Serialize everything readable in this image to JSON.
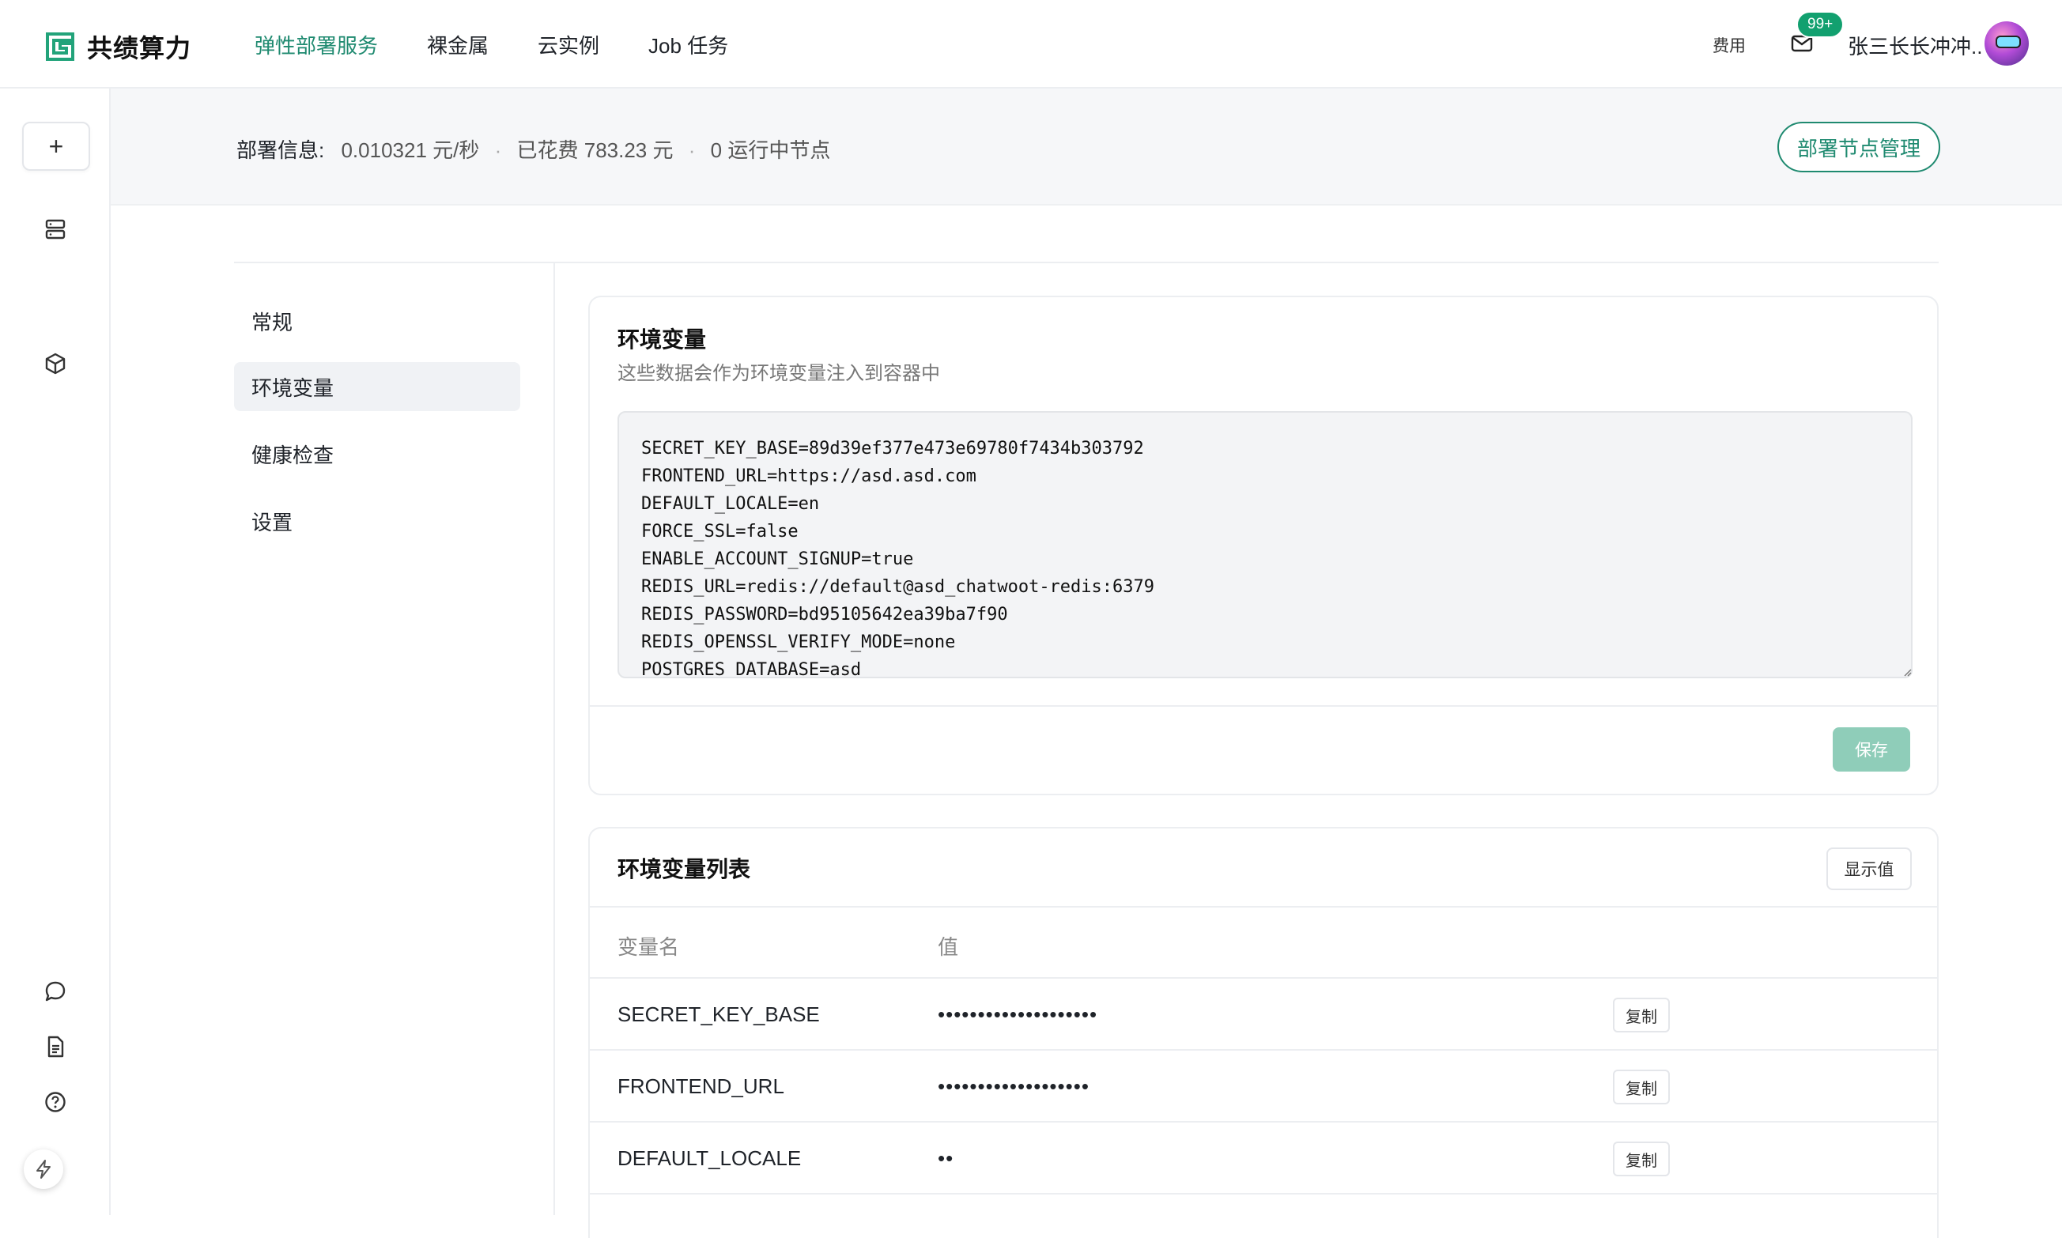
{
  "header": {
    "brand": "共绩算力",
    "nav": [
      "弹性部署服务",
      "裸金属",
      "云实例",
      "Job 任务"
    ],
    "fee_label": "费用",
    "badge_count": "99+",
    "username": "张三长长冲冲..",
    "accent_color": "#1f8a70"
  },
  "rail": {
    "add_label": "+",
    "icons": [
      "server-icon",
      "cube-icon",
      "chat-icon",
      "document-icon",
      "help-icon",
      "bolt-icon"
    ]
  },
  "info": {
    "label": "部署信息:",
    "rate": "0.010321 元/秒",
    "spent": "已花费 783.23 元",
    "nodes": "0 运行中节点",
    "manage_button": "部署节点管理"
  },
  "settings_nav": [
    "常规",
    "环境变量",
    "健康检查",
    "设置"
  ],
  "env_editor": {
    "title": "环境变量",
    "subtitle": "这些数据会作为环境变量注入到容器中",
    "content": "SECRET_KEY_BASE=89d39ef377e473e69780f7434b303792\nFRONTEND_URL=https://asd.asd.com\nDEFAULT_LOCALE=en\nFORCE_SSL=false\nENABLE_ACCOUNT_SIGNUP=true\nREDIS_URL=redis://default@asd_chatwoot-redis:6379\nREDIS_PASSWORD=bd95105642ea39ba7f90\nREDIS_OPENSSL_VERIFY_MODE=none\nPOSTGRES_DATABASE=asd",
    "save_label": "保存"
  },
  "env_list": {
    "title": "环境变量列表",
    "show_button": "显示值",
    "col_name": "变量名",
    "col_value": "值",
    "rows": [
      {
        "name": "SECRET_KEY_BASE",
        "value": "••••••••••••••••••••",
        "copy": "复制"
      },
      {
        "name": "FRONTEND_URL",
        "value": "•••••••••••••••••••",
        "copy": "复制"
      },
      {
        "name": "DEFAULT_LOCALE",
        "value": "••",
        "copy": "复制"
      }
    ]
  }
}
